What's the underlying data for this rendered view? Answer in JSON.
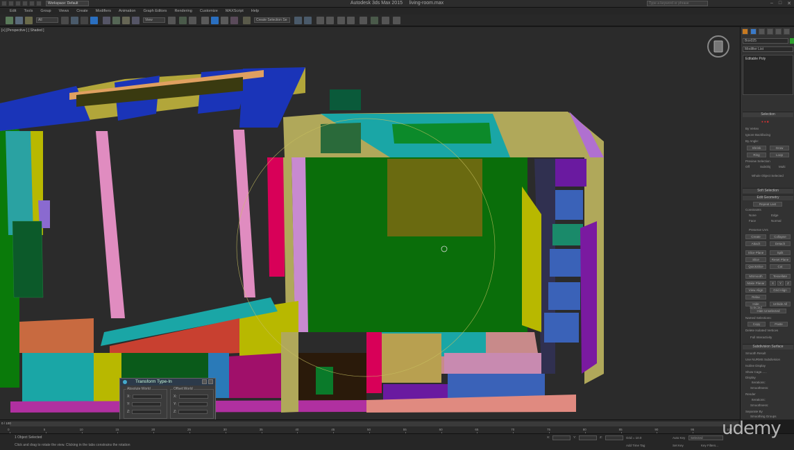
{
  "title_bar": {
    "workspace": "Workspace: Default",
    "app_title": "Autodesk 3ds Max  2015",
    "file_name": "living-room.max",
    "search_placeholder": "Type a keyword or phrase"
  },
  "menu": [
    "Edit",
    "Tools",
    "Group",
    "Views",
    "Create",
    "Modifiers",
    "Animation",
    "Graph Editors",
    "Rendering",
    "Customize",
    "MAXScript",
    "Help"
  ],
  "toolbar": {
    "selection_filter": "All",
    "ref_coord": "View",
    "named_selection": "Create Selection Se"
  },
  "viewport": {
    "label": "[+] [Perspective ] [ Shaded ]"
  },
  "transform_dialog": {
    "title": "Transform Type-In",
    "absolute_label": "Absolute:World",
    "offset_label": "Offset:World",
    "axes": [
      "X:",
      "Y:",
      "Z:"
    ]
  },
  "command_panel": {
    "object_name": "Box025",
    "modifier_list": "Modifier List",
    "stack_item": "Editable Poly",
    "rollouts": {
      "selection": "Selection",
      "soft_selection": "Soft Selection",
      "edit_geometry": "Edit Geometry",
      "subdivision_surface": "Subdivision Surface"
    },
    "selection_opts": [
      "By Vertex",
      "Ignore Backfacing",
      "By Angle:",
      "Shrink",
      "Grow",
      "Ring",
      "Loop"
    ],
    "preview_selection": "Preview Selection",
    "preview_opts": [
      "Off",
      "SubObj",
      "Multi"
    ],
    "whole_object": "Whole Object Selected",
    "edit_geometry": {
      "repeat_last": "Repeat Last",
      "constraints": "Constraints",
      "constraint_opts": [
        "None",
        "Edge",
        "Face",
        "Normal"
      ],
      "preserve_uvs": "Preserve UVs",
      "create": "Create",
      "collapse": "Collapse",
      "attach": "Attach",
      "detach": "Detach",
      "slice_plane": "Slice Plane",
      "split": "Split",
      "slice": "Slice",
      "reset_plane": "Reset Plane",
      "quickslice": "QuickSlice",
      "cut": "Cut",
      "msmooth": "MSmooth",
      "tessellate": "Tessellate",
      "make_planar": "Make Planar",
      "xyz": [
        "X",
        "Y",
        "Z"
      ],
      "view_align": "View Align",
      "grid_align": "Grid Align",
      "relax": "Relax",
      "hide_selected": "Hide Selected",
      "unhide_all": "Unhide All",
      "hide_unselected": "Hide Unselected",
      "named_selections": "Named Selections:",
      "copy": "Copy",
      "paste": "Paste",
      "delete_isolated": "Delete Isolated Vertices",
      "full_interactivity": "Full Interactivity"
    },
    "subdivision": {
      "smooth_result": "Smooth Result",
      "use_nurms": "Use NURMS Subdivision",
      "isoline_display": "Isoline Display",
      "show_cage": "Show Cage......",
      "display": "Display",
      "iterations": "Iterations:",
      "smoothness": "Smoothness:",
      "render": "Render",
      "separate_by": "Separate By",
      "smoothing_groups": "Smoothing Groups",
      "materials": "Materials"
    }
  },
  "timeline": {
    "slider_label": "0 / 100",
    "ticks": [
      "0",
      "5",
      "10",
      "15",
      "20",
      "25",
      "30",
      "35",
      "40",
      "45",
      "50",
      "55",
      "60",
      "65",
      "70",
      "75",
      "80",
      "85",
      "90",
      "95",
      "100"
    ]
  },
  "status_bar": {
    "selection_msg": "1 Object Selected",
    "prompt": "Click and drag to rotate the view.  Clicking in the tabs constrains the rotation",
    "x_label": "X:",
    "y_label": "Y:",
    "z_label": "Z:",
    "grid": "Grid = 10.0",
    "auto_key": "Auto Key",
    "set_key": "Set Key",
    "selected": "Selected",
    "add_time_tag": "Add Time Tag",
    "key_filters": "Key Filters...",
    "frame": "0"
  },
  "watermark": "udemy"
}
